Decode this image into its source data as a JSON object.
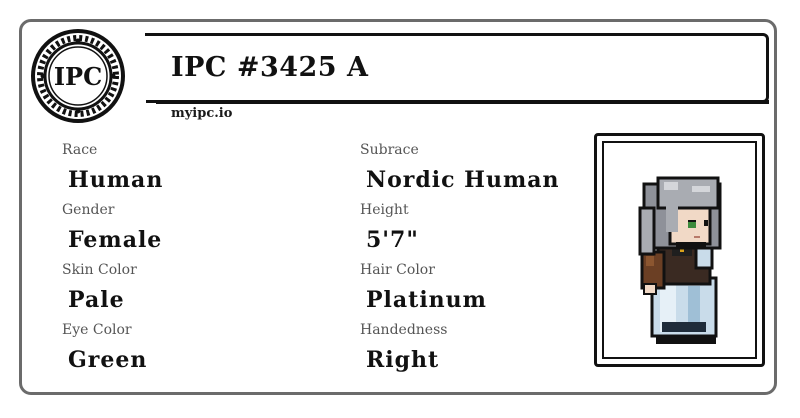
{
  "header": {
    "name": "IPC #3425 A",
    "site": "myipc.io",
    "logo_text": "IPC"
  },
  "attributes": [
    {
      "label": "Race",
      "value": "Human"
    },
    {
      "label": "Subrace",
      "value": "Nordic Human"
    },
    {
      "label": "Gender",
      "value": "Female"
    },
    {
      "label": "Height",
      "value": "5'7\""
    },
    {
      "label": "Skin Color",
      "value": "Pale"
    },
    {
      "label": "Hair Color",
      "value": "Platinum"
    },
    {
      "label": "Eye Color",
      "value": "Green"
    },
    {
      "label": "Handedness",
      "value": "Right"
    }
  ],
  "colors": {
    "card_border": "#6b6b6b",
    "text_dark": "#111111",
    "label_gray": "#555555",
    "hair": "#a9acb2",
    "dress": "#c9dcea",
    "coat": "#6b3f24"
  },
  "icons": {
    "logo": "ipc-seal-logo",
    "portrait": "pixel-character-portrait"
  }
}
